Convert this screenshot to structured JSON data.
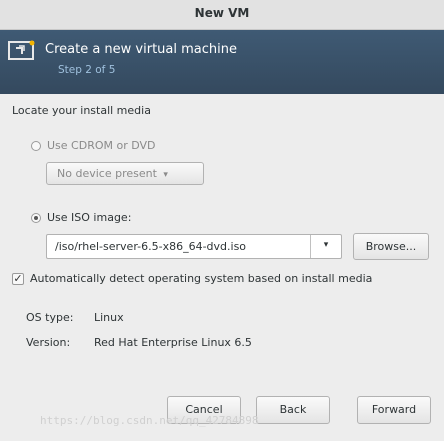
{
  "window": {
    "title": "New VM"
  },
  "banner": {
    "title": "Create a new virtual machine",
    "step": "Step 2 of 5",
    "icon": "monitor-icon"
  },
  "section": {
    "label": "Locate your install media"
  },
  "cdrom": {
    "label": "Use CDROM or DVD",
    "selected": false,
    "device_value": "No device present"
  },
  "iso": {
    "label": "Use ISO image:",
    "selected": true,
    "path": "/iso/rhel-server-6.5-x86_64-dvd.iso",
    "browse_label": "Browse..."
  },
  "detect": {
    "label": "Automatically detect operating system based on install media",
    "checked": true
  },
  "os": {
    "type_label": "OS type:",
    "type_value": "Linux",
    "version_label": "Version:",
    "version_value": "Red Hat Enterprise Linux 6.5"
  },
  "buttons": {
    "cancel": "Cancel",
    "back": "Back",
    "forward": "Forward"
  },
  "watermark": "https://blog.csdn.net/qq_42784898"
}
